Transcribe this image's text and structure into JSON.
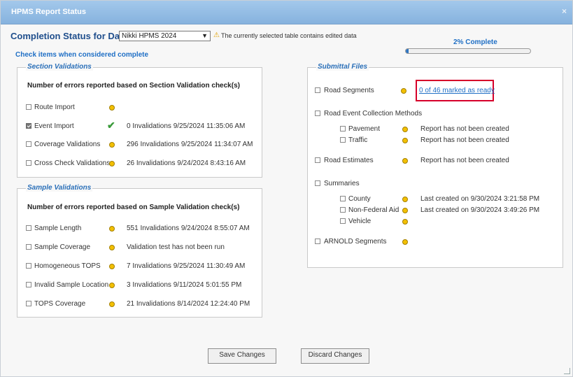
{
  "window": {
    "title": "HPMS Report Status",
    "close_glyph": "×"
  },
  "header": {
    "completion_label": "Completion Status for Data",
    "data_select": {
      "value": "Nikki HPMS 2024"
    },
    "warning_text": "The currently selected table contains edited data",
    "progress": {
      "text": "2% Complete",
      "percent": 2
    },
    "check_items_text": "Check items when considered complete"
  },
  "section_validations": {
    "legend": "Section Validations",
    "heading": "Number of errors reported based on Section Validation check(s)",
    "items": [
      {
        "label": "Route Import",
        "checked": false,
        "status": "dot",
        "info": ""
      },
      {
        "label": "Event Import",
        "checked": true,
        "status": "check",
        "info": "0 Invalidations 9/25/2024 11:35:06 AM"
      },
      {
        "label": "Coverage Validations",
        "checked": false,
        "status": "dot",
        "info": "296 Invalidations 9/25/2024 11:34:07 AM"
      },
      {
        "label": "Cross Check Validations",
        "checked": false,
        "status": "dot",
        "info": "26 Invalidations 9/24/2024 8:43:16 AM"
      }
    ]
  },
  "sample_validations": {
    "legend": "Sample Validations",
    "heading": "Number of errors reported based on Sample Validation check(s)",
    "items": [
      {
        "label": "Sample Length",
        "info": "551 Invalidations 9/24/2024 8:55:07 AM"
      },
      {
        "label": "Sample Coverage",
        "info": "Validation test has not been run"
      },
      {
        "label": "Homogeneous TOPS",
        "info": "7 Invalidations 9/25/2024 11:30:49 AM"
      },
      {
        "label": "Invalid Sample Location",
        "info": "3 Invalidations 9/11/2024 5:01:55 PM"
      },
      {
        "label": "TOPS Coverage",
        "info": "21 Invalidations 8/14/2024 12:24:40 PM"
      }
    ]
  },
  "submittal_files": {
    "legend": "Submittal Files",
    "road_segments": {
      "label": "Road Segments",
      "link": "0 of 46 marked as ready"
    },
    "rec_methods": {
      "label": "Road Event Collection Methods",
      "items": [
        {
          "label": "Pavement",
          "info": "Report has not been created"
        },
        {
          "label": "Traffic",
          "info": "Report has not been created"
        }
      ]
    },
    "road_estimates": {
      "label": "Road Estimates",
      "info": "Report has not been created"
    },
    "summaries": {
      "label": "Summaries",
      "items": [
        {
          "label": "County",
          "info": "Last created on 9/30/2024 3:21:58 PM"
        },
        {
          "label": "Non-Federal Aid",
          "info": "Last created on 9/30/2024 3:49:26 PM"
        },
        {
          "label": "Vehicle",
          "info": ""
        }
      ]
    },
    "arnold": {
      "label": "ARNOLD Segments"
    }
  },
  "buttons": {
    "save": "Save Changes",
    "discard": "Discard Changes"
  }
}
